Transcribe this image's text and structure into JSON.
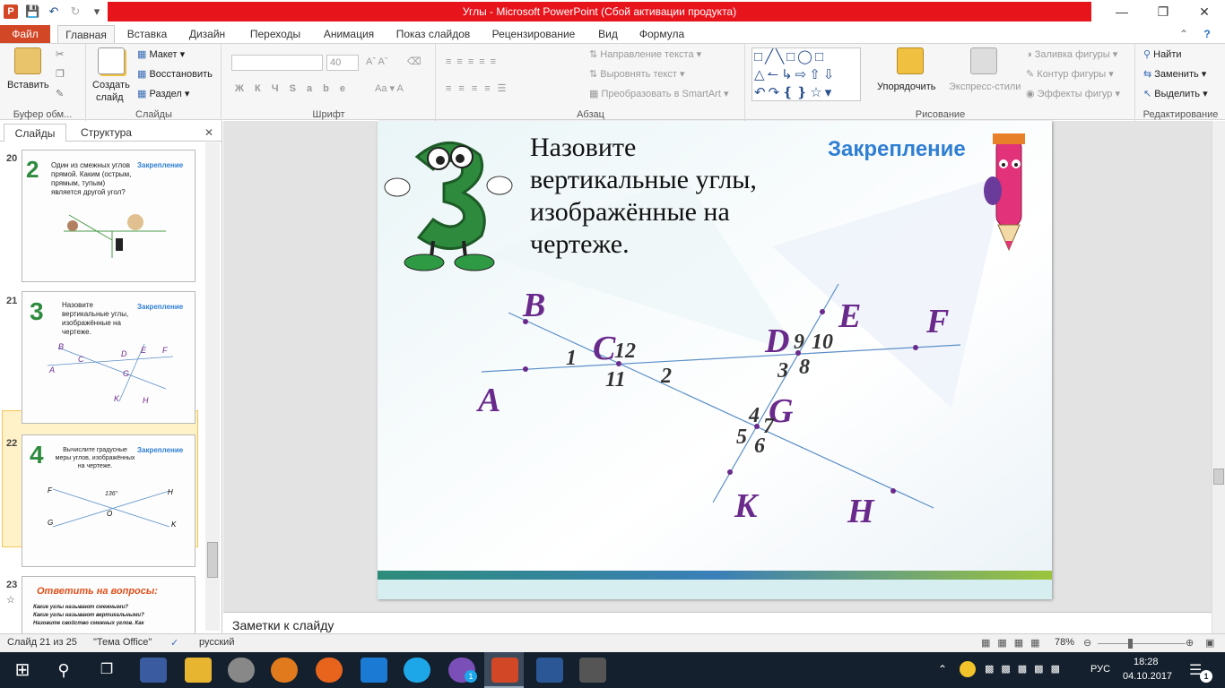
{
  "window": {
    "title": "Углы - Microsoft PowerPoint (Сбой активации продукта)"
  },
  "tabs": [
    "Файл",
    "Главная",
    "Вставка",
    "Дизайн",
    "Переходы",
    "Анимация",
    "Показ слайдов",
    "Рецензирование",
    "Вид",
    "Формула"
  ],
  "ribbon": {
    "clipboard": {
      "label": "Буфер обм...",
      "paste": "Вставить"
    },
    "slides": {
      "label": "Слайды",
      "new_slide_1": "Создать",
      "new_slide_2": "слайд",
      "layout": "Макет",
      "restore": "Восстановить",
      "section": "Раздел"
    },
    "font": {
      "label": "Шрифт",
      "size": "40"
    },
    "paragraph": {
      "label": "Абзац",
      "text_dir": "Направление текста",
      "align_text": "Выровнять текст",
      "smartart": "Преобразовать в SmartArt"
    },
    "drawing": {
      "label": "Рисование",
      "arrange": "Упорядочить",
      "quick_styles": "Экспресс-стили",
      "fill": "Заливка фигуры",
      "outline": "Контур фигуры",
      "effects": "Эффекты фигур"
    },
    "editing": {
      "label": "Редактирование",
      "find": "Найти",
      "replace": "Заменить",
      "select": "Выделить"
    }
  },
  "left_panel": {
    "tab_slides": "Слайды",
    "tab_outline": "Структура",
    "thumbs": [
      {
        "num": "20",
        "text": "Один из смежных углов прямой. Каким (острым, прямым, тупым) является другой угол?",
        "tag": "Закрепление"
      },
      {
        "num": "21",
        "text": "Назовите вертикальные углы, изображённые на чертеже.",
        "tag": "Закрепление"
      },
      {
        "num": "22",
        "text": "Вычислите градусные меры углов, изображённых на чертеже.",
        "tag": "Закрепление",
        "angle": "136°"
      },
      {
        "num": "23",
        "text": "Ответить на вопросы:",
        "items": [
          "Какие углы называют смежными?",
          "Какие углы называют вертикальными?",
          "Назовите свойство смежных углов. Как"
        ]
      }
    ]
  },
  "slide": {
    "title": "Назовите вертикальные углы, изображённые на чертеже.",
    "title_lines": [
      "Назовите",
      "вертикальные углы,",
      "изображённые на",
      "чертеже."
    ],
    "badge": "Закрепление",
    "points": [
      "B",
      "C",
      "D",
      "E",
      "F",
      "A",
      "G",
      "K",
      "H"
    ],
    "angles": [
      "1",
      "12",
      "2",
      "11",
      "9",
      "10",
      "3",
      "8",
      "4",
      "7",
      "5",
      "6"
    ]
  },
  "notes": {
    "placeholder": "Заметки к слайду"
  },
  "status": {
    "slide": "Слайд 21 из 25",
    "theme": "\"Тема Office\"",
    "lang": "русский",
    "zoom": "78%"
  },
  "taskbar": {
    "lang": "РУС",
    "time": "18:28",
    "date": "04.10.2017",
    "badge": "1"
  }
}
